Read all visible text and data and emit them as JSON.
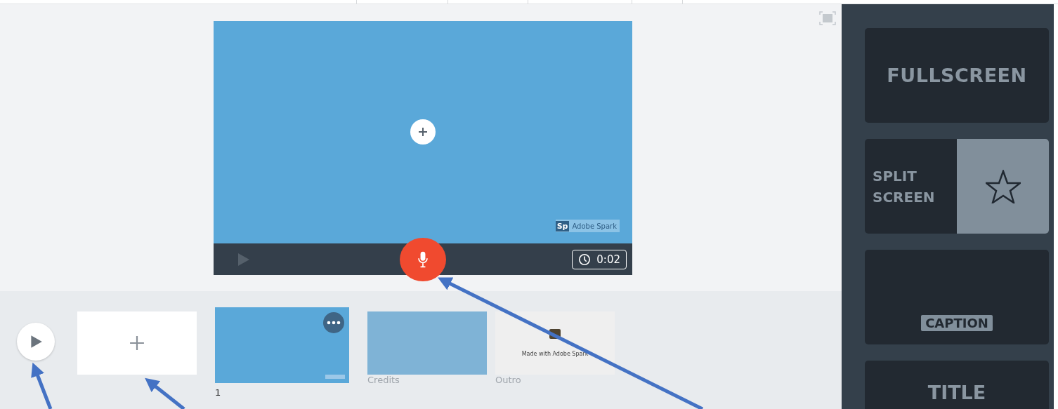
{
  "video": {
    "watermark": {
      "badge": "Sp",
      "text": "Adobe Spark"
    },
    "duration": "0:02"
  },
  "timeline": {
    "slides": [
      {
        "kind": "slide",
        "label": "1",
        "selected": true
      },
      {
        "kind": "credits",
        "label": "Credits",
        "selected": false
      },
      {
        "kind": "outro",
        "label": "Outro",
        "selected": false,
        "caption": "Made with Adobe Spark"
      }
    ]
  },
  "layouts": [
    {
      "kind": "fullscreen",
      "label": "FULLSCREEN"
    },
    {
      "kind": "split",
      "label": "SPLIT SCREEN"
    },
    {
      "kind": "caption",
      "label": "CAPTION"
    },
    {
      "kind": "title",
      "label": "TITLE"
    }
  ]
}
